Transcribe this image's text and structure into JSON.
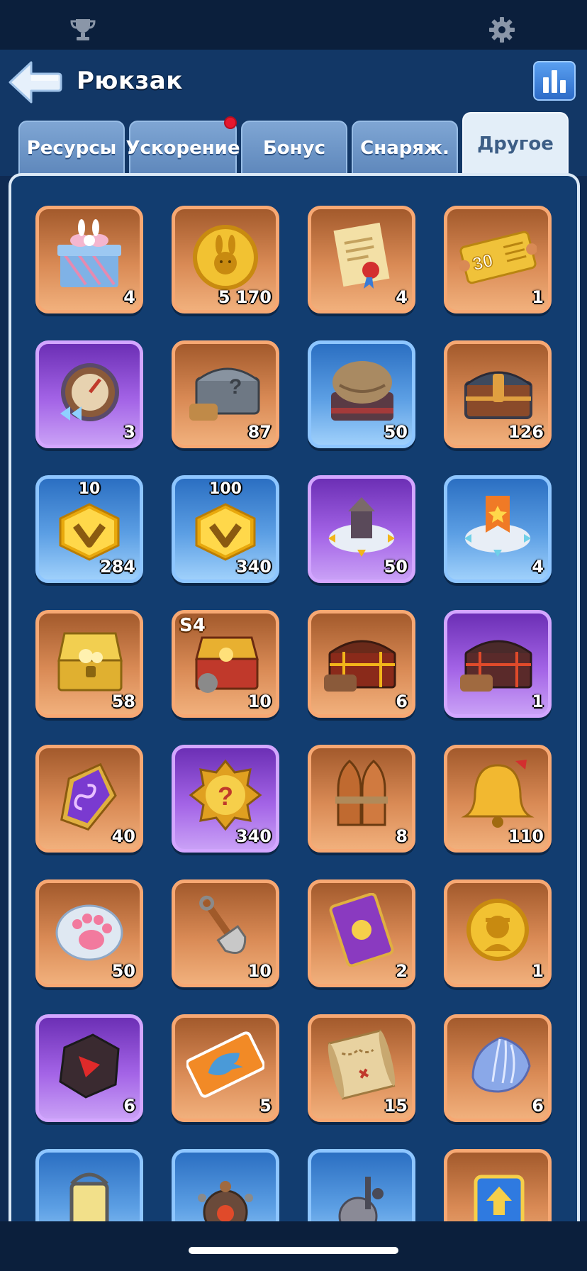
{
  "header": {
    "title": "Рюкзак"
  },
  "tabs": [
    {
      "label": "Ресурсы",
      "active": false,
      "notify": false
    },
    {
      "label": "Ускорение",
      "active": false,
      "notify": true
    },
    {
      "label": "Бонус",
      "active": false,
      "notify": false
    },
    {
      "label": "Снаряж.",
      "active": false,
      "notify": false
    },
    {
      "label": "Другое",
      "active": true,
      "notify": false
    }
  ],
  "colors": {
    "accent_orange": "#f7a873",
    "accent_purple": "#d3a6ff",
    "accent_blue": "#8ec6ff",
    "notify_dot": "#e6182e"
  },
  "items": [
    {
      "icon": "gift-box-icon",
      "frame": "orange",
      "count": "4"
    },
    {
      "icon": "bunny-coin-icon",
      "frame": "orange",
      "count": "5 170"
    },
    {
      "icon": "scroll-with-seal-icon",
      "frame": "orange",
      "count": "4"
    },
    {
      "icon": "ticket-30-icon",
      "frame": "orange",
      "count": "1",
      "label": "30"
    },
    {
      "icon": "compass-speedup-icon",
      "frame": "purple",
      "count": "3"
    },
    {
      "icon": "mystery-chest-icon",
      "frame": "orange",
      "count": "87"
    },
    {
      "icon": "sack-chest-icon",
      "frame": "blue",
      "count": "50"
    },
    {
      "icon": "iron-chest-icon",
      "frame": "orange",
      "count": "126"
    },
    {
      "icon": "gold-hexagon-10-icon",
      "frame": "blue",
      "count": "284",
      "tag": "10"
    },
    {
      "icon": "gold-hexagon-100-icon",
      "frame": "blue",
      "count": "340",
      "tag": "100"
    },
    {
      "icon": "teleport-building-icon",
      "frame": "purple",
      "count": "50"
    },
    {
      "icon": "teleport-banner-icon",
      "frame": "blue",
      "count": "4"
    },
    {
      "icon": "gold-treasure-chest-icon",
      "frame": "orange",
      "count": "58"
    },
    {
      "icon": "s4-treasure-chest-icon",
      "frame": "orange",
      "count": "10",
      "season": "S4"
    },
    {
      "icon": "red-gear-chest-icon",
      "frame": "orange",
      "count": "6"
    },
    {
      "icon": "dark-gear-chest-icon",
      "frame": "purple",
      "count": "1"
    },
    {
      "icon": "purple-rune-stone-icon",
      "frame": "orange",
      "count": "40"
    },
    {
      "icon": "gold-mystery-medal-icon",
      "frame": "purple",
      "count": "340"
    },
    {
      "icon": "rocket-bundle-icon",
      "frame": "orange",
      "count": "8"
    },
    {
      "icon": "bell-icon",
      "frame": "orange",
      "count": "110"
    },
    {
      "icon": "paw-cookie-icon",
      "frame": "orange",
      "count": "50"
    },
    {
      "icon": "shovel-icon",
      "frame": "orange",
      "count": "10"
    },
    {
      "icon": "purple-card-icon",
      "frame": "orange",
      "count": "2"
    },
    {
      "icon": "hero-coin-icon",
      "frame": "orange",
      "count": "1"
    },
    {
      "icon": "red-ore-icon",
      "frame": "purple",
      "count": "6"
    },
    {
      "icon": "fish-ticket-icon",
      "frame": "orange",
      "count": "5"
    },
    {
      "icon": "treasure-map-icon",
      "frame": "orange",
      "count": "15"
    },
    {
      "icon": "blue-shell-icon",
      "frame": "orange",
      "count": "6"
    },
    {
      "icon": "lantern-icon",
      "frame": "blue",
      "count": ""
    },
    {
      "icon": "robot-drone-icon",
      "frame": "blue",
      "count": ""
    },
    {
      "icon": "fishing-reel-icon",
      "frame": "blue",
      "count": ""
    },
    {
      "icon": "upgrade-box-icon",
      "frame": "orange",
      "count": ""
    }
  ]
}
